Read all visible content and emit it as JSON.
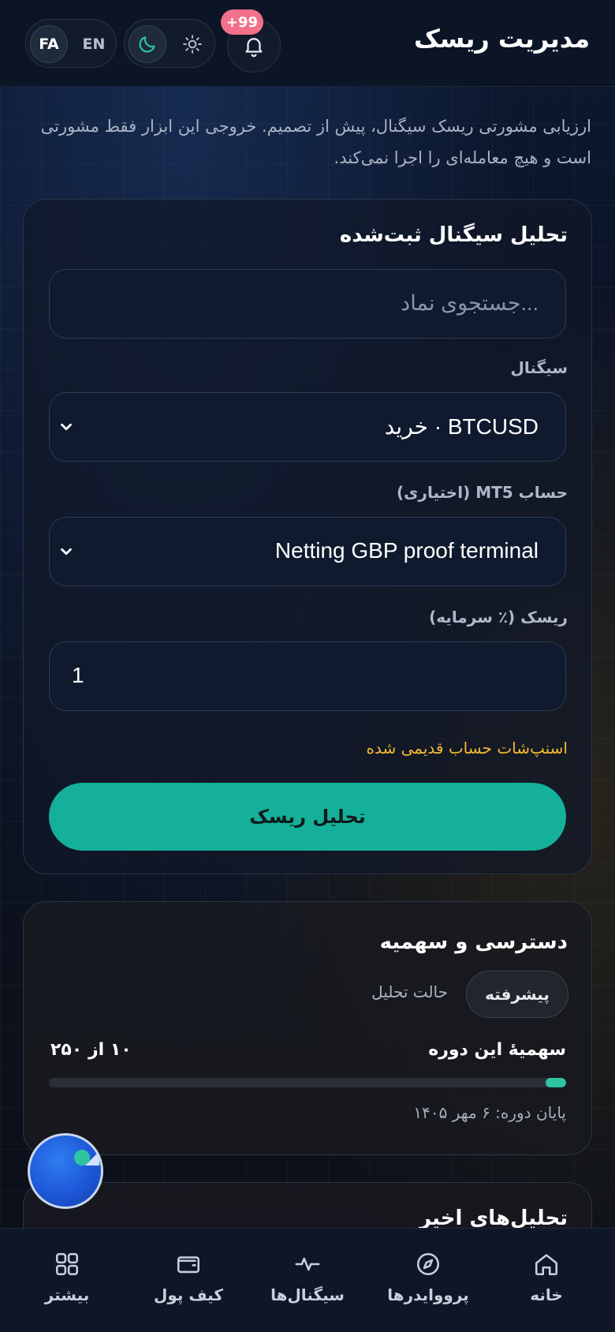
{
  "header": {
    "title": "مدیریت ریسک",
    "lang_fa": "FA",
    "lang_en": "EN",
    "notification_badge": "+99"
  },
  "intro": "ارزیابی مشورتی ریسک سیگنال، پیش از تصمیم. خروجی این ابزار فقط مشورتی است و هیچ معامله‌ای را اجرا نمی‌کند.",
  "analysis_card": {
    "title": "تحلیل سیگنال ثبت‌شده",
    "search_placeholder": "...جستجوی نماد",
    "signal_label": "سیگنال",
    "signal_value": "BTCUSD · خرید",
    "account_label": "حساب MT5 (اختیاری)",
    "account_value": "Netting GBP proof terminal",
    "risk_label": "ریسک (٪ سرمایه)",
    "risk_value": "1",
    "warning": "اسنپ‌شات حساب قدیمی شده",
    "submit_label": "تحلیل ریسک"
  },
  "quota_card": {
    "title": "دسترسی و سهمیه",
    "mode_chip": "پیشرفته",
    "mode_label": "حالت تحلیل",
    "quota_title": "سهمیهٔ این دوره",
    "quota_value": "۱۰ از ۲۵۰",
    "quota_used": 10,
    "quota_total": 250,
    "period_end": "پایان دوره: ۶ مهر ۱۴۰۵"
  },
  "recent_card": {
    "title": "تحلیل‌های اخیر"
  },
  "bottom_nav": {
    "home": "خانه",
    "providers": "پرووایدرها",
    "signals": "سیگنال‌ها",
    "wallet": "کیف پول",
    "more": "بیشتر"
  },
  "colors": {
    "accent": "#15b09a",
    "warning": "#f5b933",
    "badge": "#f2708a"
  },
  "icons": [
    "bell-icon",
    "moon-icon",
    "sun-icon",
    "chevron-down-icon",
    "home-icon",
    "compass-icon",
    "pulse-icon",
    "wallet-icon",
    "grid-icon"
  ]
}
